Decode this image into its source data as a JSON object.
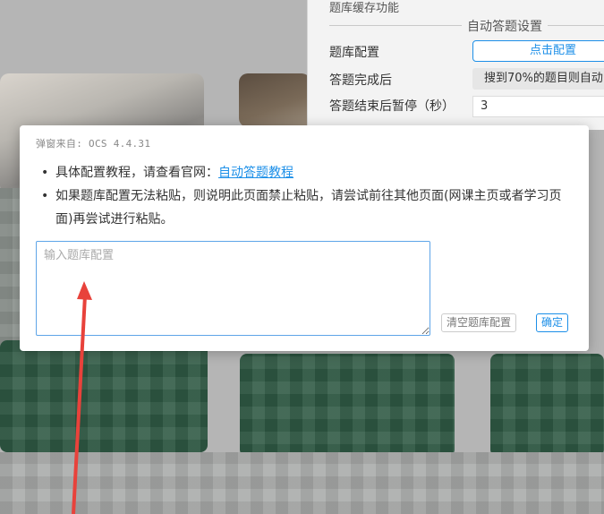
{
  "settings_panel": {
    "top_text": "题库缓存功能",
    "section_title": "自动答题设置",
    "rows": [
      {
        "label": "题库配置",
        "control": "点击配置"
      },
      {
        "label": "答题完成后",
        "control": "搜到70%的题目则自动"
      },
      {
        "label": "答题结束后暂停（秒）",
        "control": "3"
      }
    ]
  },
  "modal": {
    "title": "弹窗来自: OCS 4.4.31",
    "items": {
      "tutorial_prefix": "具体配置教程，请查看官网：",
      "tutorial_link": "自动答题教程",
      "paste_hint": "如果题库配置无法粘贴，则说明此页面禁止粘贴，请尝试前往其他页面(网课主页或者学习页面)再尝试进行粘贴。"
    },
    "textarea_placeholder": "输入题库配置",
    "textarea_value": "",
    "clear_button": "清空题库配置",
    "ok_button": "确定"
  },
  "colors": {
    "accent": "#1c8fe8",
    "annotation_arrow": "#e8423b"
  }
}
